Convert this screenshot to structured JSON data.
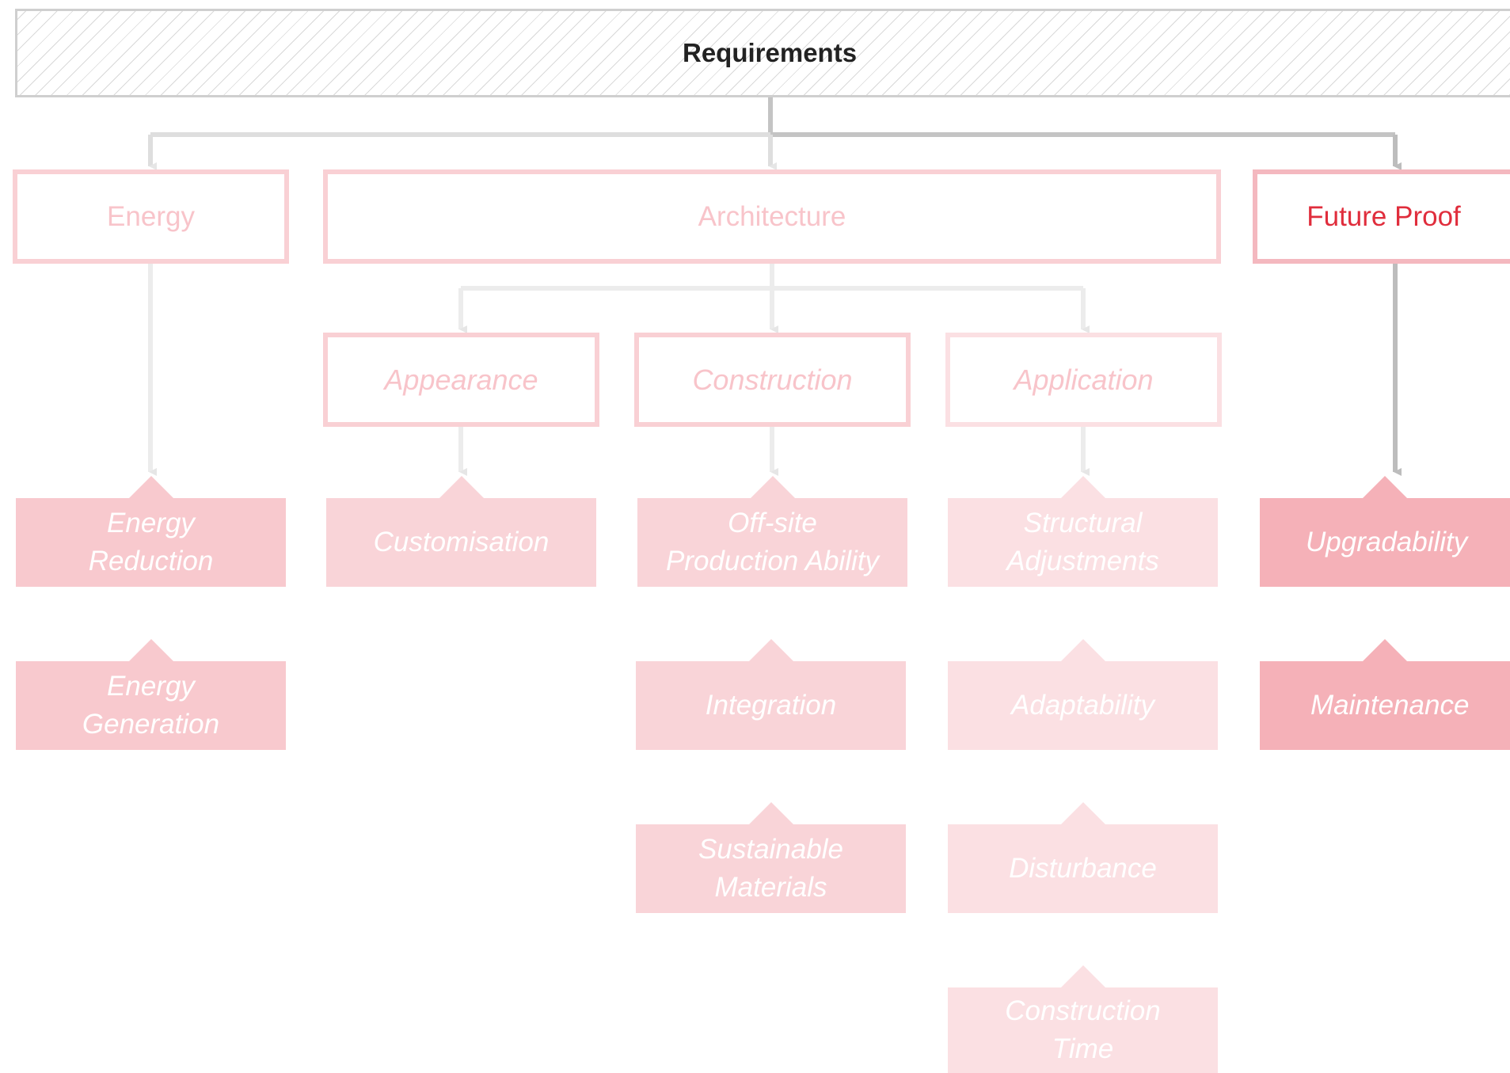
{
  "diagram": {
    "title": "Requirements",
    "categories": {
      "energy": "Energy",
      "architecture": "Architecture",
      "future_proof": "Future Proof"
    },
    "subcategories": {
      "appearance": "Appearance",
      "construction": "Construction",
      "application": "Application"
    },
    "leaves": {
      "energy_reduction": "Energy\nReduction",
      "energy_generation": "Energy\nGeneration",
      "customisation": "Customisation",
      "offsite_production": "Off-site\nProduction Ability",
      "integration": "Integration",
      "sustainable_materials": "Sustainable\nMaterials",
      "structural_adjustments": "Structural\nAdjustments",
      "adaptability": "Adaptability",
      "disturbance": "Disturbance",
      "construction_time": "Construction\nTime",
      "upgradability": "Upgradability",
      "maintenance": "Maintenance"
    },
    "colors": {
      "highlight_text": "#e02d3c",
      "faded_text": "#f8c4ca",
      "connector_gray": "#c4c4c4",
      "connector_faint": "#ececec",
      "highlight_leaf": "#f5b1b8",
      "faded_leaf": "#f8c9ce"
    }
  }
}
